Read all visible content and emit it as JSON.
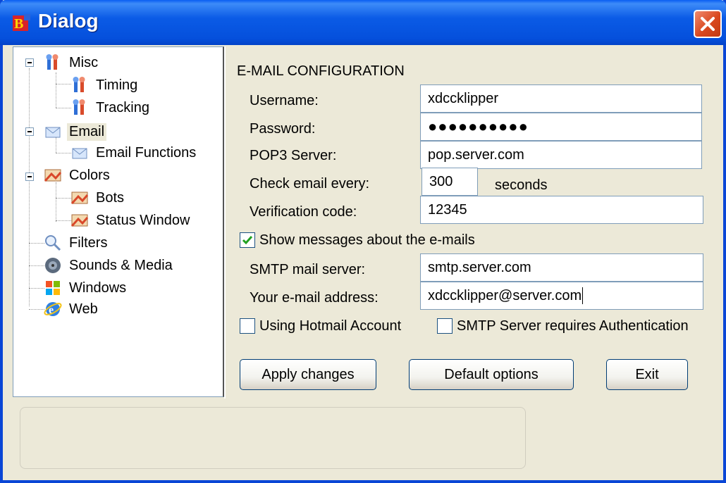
{
  "window": {
    "title": "Dialog",
    "close_icon": "close-icon",
    "colors": {
      "titlebar": "#0550dc",
      "face": "#ece9d8",
      "check": "#21a121"
    }
  },
  "tree": {
    "items": [
      {
        "label": "Misc",
        "icon": "tools-icon"
      },
      {
        "label": "Timing",
        "icon": "tools-icon"
      },
      {
        "label": "Tracking",
        "icon": "tools-icon"
      },
      {
        "label": "Email",
        "icon": "envelope-icon",
        "selected": true
      },
      {
        "label": "Email Functions",
        "icon": "envelope-icon"
      },
      {
        "label": "Colors",
        "icon": "palette-icon"
      },
      {
        "label": "Bots",
        "icon": "palette-icon"
      },
      {
        "label": "Status Window",
        "icon": "palette-icon"
      },
      {
        "label": "Filters",
        "icon": "magnifier-icon"
      },
      {
        "label": "Sounds & Media",
        "icon": "speaker-icon"
      },
      {
        "label": "Windows",
        "icon": "windows-logo-icon"
      },
      {
        "label": "Web",
        "icon": "internet-explorer-icon"
      }
    ]
  },
  "email": {
    "section_title": "E-MAIL CONFIGURATION",
    "username_label": "Username:",
    "username_value": "xdcck​lipper",
    "password_label": "Password:",
    "password_value": "●●●●●●●●●●",
    "pop3_label": "POP3 Server:",
    "pop3_value": "pop.server.com",
    "check_label": "Check email every:",
    "check_value": "300",
    "check_unit": "seconds",
    "verification_label": "Verification code:",
    "verification_value": "12345",
    "show_messages_label": "Show messages about the e-mails",
    "show_messages_checked": true,
    "smtp_label": "SMTP mail server:",
    "smtp_value": "smtp.server.com",
    "address_label": "Your e-mail address:",
    "address_value": "xdccklipper@server.com",
    "hotmail_label": "Using Hotmail Account",
    "hotmail_checked": false,
    "smtp_auth_label": "SMTP Server requires Authentication",
    "smtp_auth_checked": false
  },
  "buttons": {
    "apply": "Apply changes",
    "defaults": "Default options",
    "exit": "Exit"
  }
}
